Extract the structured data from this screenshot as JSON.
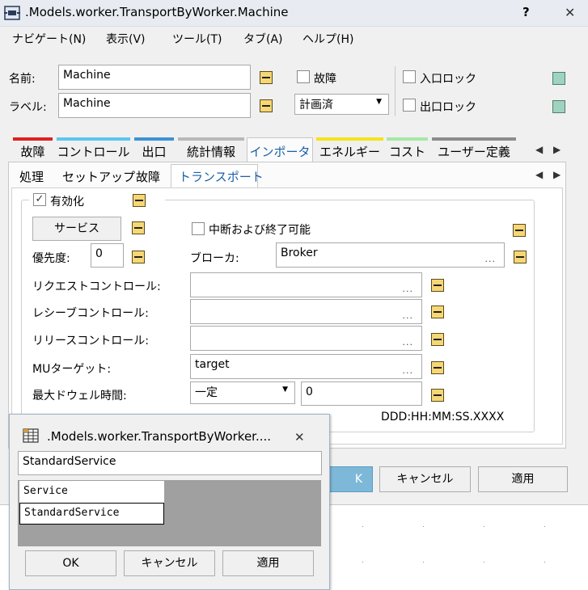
{
  "main_window": {
    "title": ".Models.worker.TransportByWorker.Machine",
    "help_glyph": "?",
    "close_glyph": "✕"
  },
  "menu": [
    "ナビゲート(N)",
    "表示(V)",
    "ツール(T)",
    "タブ(A)",
    "ヘルプ(H)"
  ],
  "header": {
    "name_label": "名前:",
    "name_value": "Machine",
    "label_label": "ラベル:",
    "label_value": "Machine",
    "failure_label": "故障",
    "failure_checked": false,
    "planned_value": "計画済",
    "entry_lock_label": "入口ロック",
    "exit_lock_label": "出口ロック"
  },
  "tabs": [
    {
      "label": "故障",
      "color": "#e02020"
    },
    {
      "label": "コントロール",
      "color": "#5cc6ef"
    },
    {
      "label": "出口",
      "color": "#3a93d6"
    },
    {
      "label": "統計情報",
      "color": "#b8b8b8"
    },
    {
      "label": "インポータ",
      "color": "#f0922e",
      "active": true
    },
    {
      "label": "エネルギー",
      "color": "#f5e31a"
    },
    {
      "label": "コスト",
      "color": "#a6e8a6"
    },
    {
      "label": "ユーザー定義",
      "color": "#8c8c8c"
    }
  ],
  "subtabs": [
    "処理",
    "セットアップ",
    "故障",
    "トランスポート"
  ],
  "active_subtab": "トランスポート",
  "transport": {
    "enabled_label": "有効化",
    "enabled_checked": true,
    "service_button": "サービス",
    "interrupt_label": "中断および終了可能",
    "interrupt_checked": false,
    "priority_label": "優先度:",
    "priority_value": "0",
    "broker_label": "ブローカ:",
    "broker_value": "Broker",
    "request_control_label": "リクエストコントロール:",
    "request_control_value": "",
    "receive_control_label": "レシーブコントロール:",
    "receive_control_value": "",
    "release_control_label": "リリースコントロール:",
    "release_control_value": "",
    "mu_target_label": "MUターゲット:",
    "mu_target_value": "target",
    "max_dwell_label": "最大ドウェル時間:",
    "max_dwell_mode": "一定",
    "max_dwell_value": "0",
    "time_format": "DDD:HH:MM:SS.XXXX",
    "ellipsis": "..."
  },
  "main_buttons": {
    "ok_partial": "K",
    "cancel": "キャンセル",
    "apply": "適用"
  },
  "popup": {
    "title": ".Models.worker.TransportByWorker....",
    "close_glyph": "✕",
    "search_value": "StandardService",
    "items": [
      "Service",
      "StandardService"
    ],
    "selected_index": 1,
    "ok": "OK",
    "cancel": "キャンセル",
    "apply": "適用"
  }
}
